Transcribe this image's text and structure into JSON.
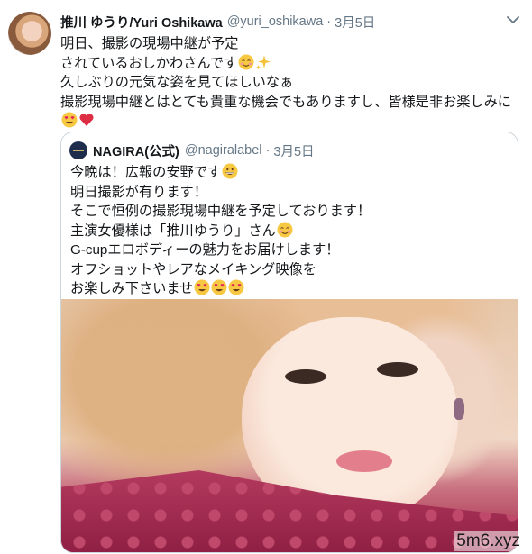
{
  "tweet": {
    "display_name": "推川 ゆうり/Yuri Oshikawa",
    "handle": "@yuri_oshikawa",
    "separator": "·",
    "date": "3月5日",
    "lines": [
      "明日、撮影の現場中継が予定",
      "されているおしかわさんです",
      "久しぶりの元気な姿を見てほしいなぁ",
      "撮影現場中継とはとても貴重な機会でもありますし、皆様是非お楽しみに"
    ],
    "icons": [
      "smiling-blush-emoji",
      "sparkles-emoji",
      "heart-eyes-emoji",
      "red-heart-emoji"
    ]
  },
  "quote": {
    "display_name": "NAGIRA(公式)",
    "handle": "@nagiralabel",
    "separator": "·",
    "date": "3月5日",
    "lines": [
      "今晩は！広報の安野です",
      "明日撮影が有ります！",
      "そこで恒例の撮影現場中継を予定しております！",
      "主演女優様は「推川ゆうり」さん",
      "G-cupエロボディーの魅力をお届けします！",
      "オフショットやレアなメイキング映像を",
      "お楽しみ下さいませ"
    ],
    "icons": [
      "grinning-emoji",
      "smiling-emoji",
      "heart-eyes-emoji"
    ]
  },
  "watermark": "5m6.xyz",
  "colors": {
    "text": "#14171a",
    "secondary": "#657786",
    "border": "#ccd6dd"
  }
}
